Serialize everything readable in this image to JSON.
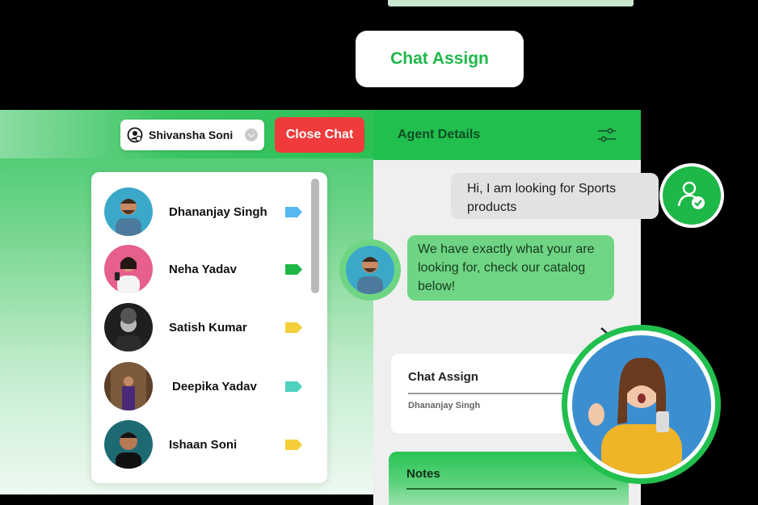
{
  "header": {
    "title": "Chat Assign"
  },
  "toolbar": {
    "agent_selected": "Shivansha Soni",
    "close_label": "Close Chat"
  },
  "contacts": [
    {
      "name": "Dhananjay Singh",
      "tag_color": "#56b8f0",
      "avatar_bg": "#3aa9c9",
      "avatar_icon": "man-denim-avatar"
    },
    {
      "name": "Neha Yadav",
      "tag_color": "#1db848",
      "avatar_bg": "#e65f8d",
      "avatar_icon": "woman-phone-avatar"
    },
    {
      "name": "Satish Kumar",
      "tag_color": "#f5cf3a",
      "avatar_bg": "#1f1f1f",
      "avatar_icon": "man-curly-avatar"
    },
    {
      "name": "Deepika Yadav",
      "tag_color": "#4fd1c0",
      "avatar_bg": "#7b5a3c",
      "avatar_icon": "woman-wood-avatar"
    },
    {
      "name": "Ishaan Soni",
      "tag_color": "#f5cf3a",
      "avatar_bg": "#1e6a73",
      "avatar_icon": "man-smile-avatar"
    }
  ],
  "agent_panel": {
    "title": "Agent Details",
    "messages": {
      "incoming": "Hi, I am looking for Sports products",
      "outgoing": "We have exactly what your are looking for, check our catalog below!"
    },
    "assign_card": {
      "title": "Chat Assign",
      "agent": "Dhananjay Singh"
    },
    "notes_card": {
      "title": "Notes"
    }
  },
  "colors": {
    "brand_green": "#21bf4e",
    "close_red": "#ef3b3b",
    "bubble_out": "#6fd584",
    "bubble_in": "#e2e2e2"
  }
}
